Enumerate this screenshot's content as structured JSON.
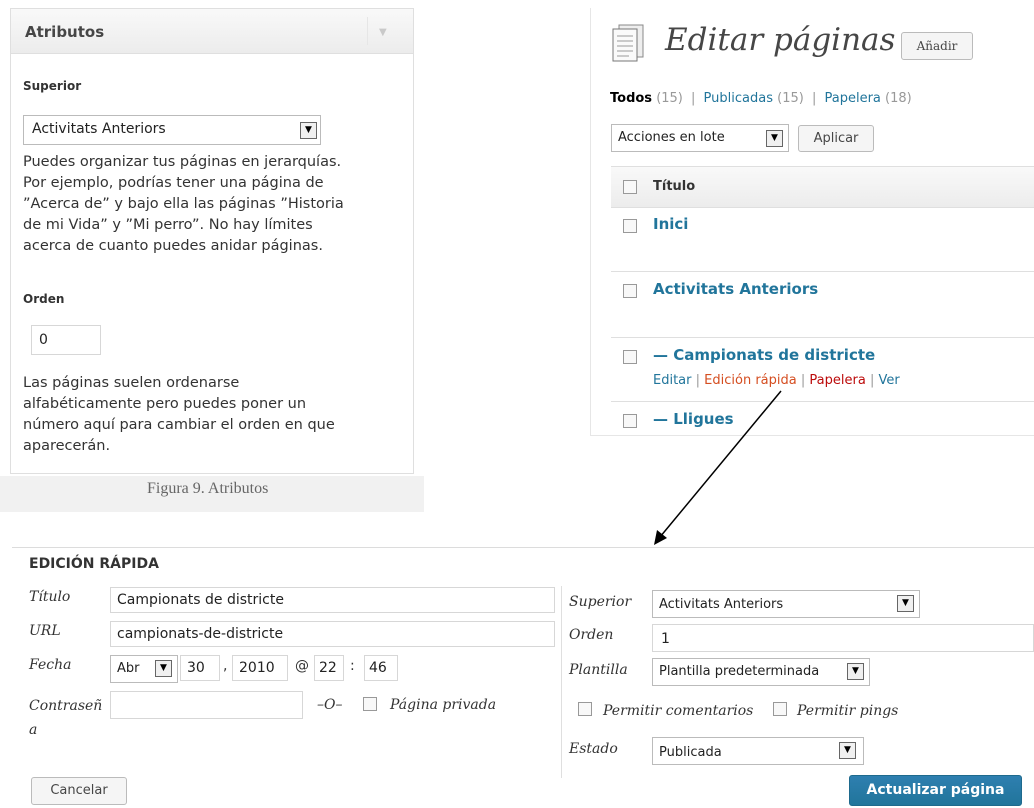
{
  "attributes_box": {
    "title": "Atributos",
    "parent_label": "Superior",
    "parent_value": "Activitats Anteriors",
    "parent_help": [
      "Puedes organizar tus páginas en jerarquías.",
      "Por ejemplo, podrías tener una página de",
      "”Acerca de” y bajo ella las páginas ”Historia",
      "de mi Vida” y ”Mi perro”. No hay límites",
      "acerca de cuanto puedes anidar páginas."
    ],
    "order_label": "Orden",
    "order_value": "0",
    "order_help": [
      "Las páginas suelen ordenarse",
      "alfabéticamente pero puedes poner un",
      "número aquí para cambiar el orden en que",
      "aparecerán."
    ],
    "caption": "Figura 9. Atributos"
  },
  "pages_list": {
    "title": "Editar páginas",
    "add_button": "Añadir",
    "filters": {
      "all_label": "Todos",
      "all_count": "(15)",
      "published_label": "Publicadas",
      "published_count": "(15)",
      "trash_label": "Papelera",
      "trash_count": "(18)",
      "sep": "|"
    },
    "bulk_select": "Acciones en lote",
    "apply_button": "Aplicar",
    "column_title": "Título",
    "rows": [
      {
        "title": "Inici"
      },
      {
        "title": "Activitats Anteriors"
      },
      {
        "title": "— Campionats de districte"
      },
      {
        "title": "— Lligues"
      }
    ],
    "row_actions": {
      "edit": "Editar",
      "quick_edit": "Edición rápida",
      "trash": "Papelera",
      "view": "Ver",
      "sep": "|"
    }
  },
  "quick_edit": {
    "heading": "EDICIÓN RÁPIDA",
    "title_label": "Título",
    "title_value": "Campionats de districte",
    "url_label": "URL",
    "url_value": "campionats-de-districte",
    "date_label": "Fecha",
    "date_month": "Abr",
    "date_day": "30",
    "date_comma": ",",
    "date_year": "2010",
    "date_at": "@",
    "date_hour": "22",
    "date_colon": ":",
    "date_minute": "46",
    "password_label_1": "Contraseñ",
    "password_label_2": "a",
    "password_value": "",
    "or_text": "–O–",
    "private_label": "Página privada",
    "parent_label": "Superior",
    "parent_value": "Activitats Anteriors",
    "order_label": "Orden",
    "order_value": "1",
    "template_label": "Plantilla",
    "template_value": "Plantilla predeterminada",
    "allow_comments": "Permitir comentarios",
    "allow_pings": "Permitir pings",
    "status_label": "Estado",
    "status_value": "Publicada",
    "cancel_button": "Cancelar",
    "update_button": "Actualizar página"
  },
  "icons": {
    "dropdown": "▼",
    "header_toggle": "▼"
  }
}
